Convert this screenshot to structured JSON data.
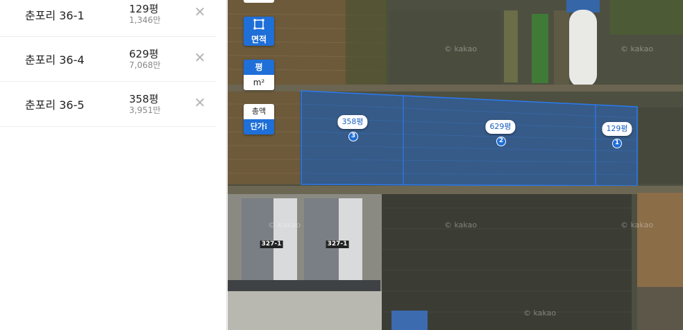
{
  "parcels": [
    {
      "name": "춘포리 36-1",
      "area": "129평",
      "price": "1,346만"
    },
    {
      "name": "춘포리 36-4",
      "area": "629평",
      "price": "7,068만"
    },
    {
      "name": "춘포리 36-5",
      "area": "358평",
      "price": "3,951만"
    }
  ],
  "map": {
    "area_button": "면적",
    "unit_pyeong": "평",
    "unit_sqm": "m²",
    "price_total": "총액",
    "price_unit": "단가⁝",
    "tags": [
      {
        "label": "358평",
        "number": "3"
      },
      {
        "label": "629평",
        "number": "2"
      },
      {
        "label": "129평",
        "number": "1"
      }
    ],
    "buildings": [
      "327-1",
      "327-1"
    ],
    "watermark": "© kakao"
  },
  "colors": {
    "accent": "#1f6fd8",
    "parcel_fill": "#2a63b0"
  }
}
